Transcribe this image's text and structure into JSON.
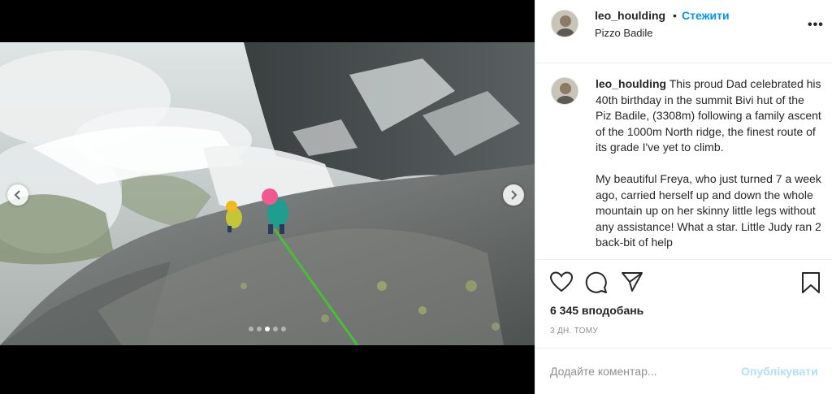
{
  "post": {
    "author": {
      "username": "leo_houlding",
      "location": "Pizzo Badile",
      "follow_label": "Стежити",
      "separator": "•"
    },
    "more_options_label": "•••",
    "caption": {
      "username": "leo_houlding",
      "paragraph_1": "This proud Dad celebrated his 40th birthday in the summit Bivi hut of the Piz Badile, (3308m) following a family ascent of the 1000m North ridge, the finest route of its grade I've yet to climb.",
      "paragraph_2": "My beautiful Freya, who just turned 7 a week ago, carried herself up and down the whole mountain up on her skinny little legs without any assistance! What a star. Little Judy ran 2 back-bit of help"
    },
    "likes_text": "6 345 вподобань",
    "timestamp": "3 ДН. ТОМУ",
    "comment": {
      "placeholder": "Додайте коментар...",
      "post_label": "Опублікувати"
    },
    "carousel": {
      "slide_count": 5,
      "active_index": 2
    }
  },
  "colors": {
    "accent": "#0095f6",
    "post_disabled": "#b2dffc",
    "text": "#262626",
    "muted": "#8e8e8e",
    "rope": "#4cbb3a",
    "helmet_pink": "#ef5b8f",
    "helmet_yellow": "#f1b81f"
  },
  "icons": [
    "chevron-left-icon",
    "chevron-right-icon",
    "heart-icon",
    "comment-icon",
    "share-icon",
    "bookmark-icon",
    "more-icon"
  ]
}
